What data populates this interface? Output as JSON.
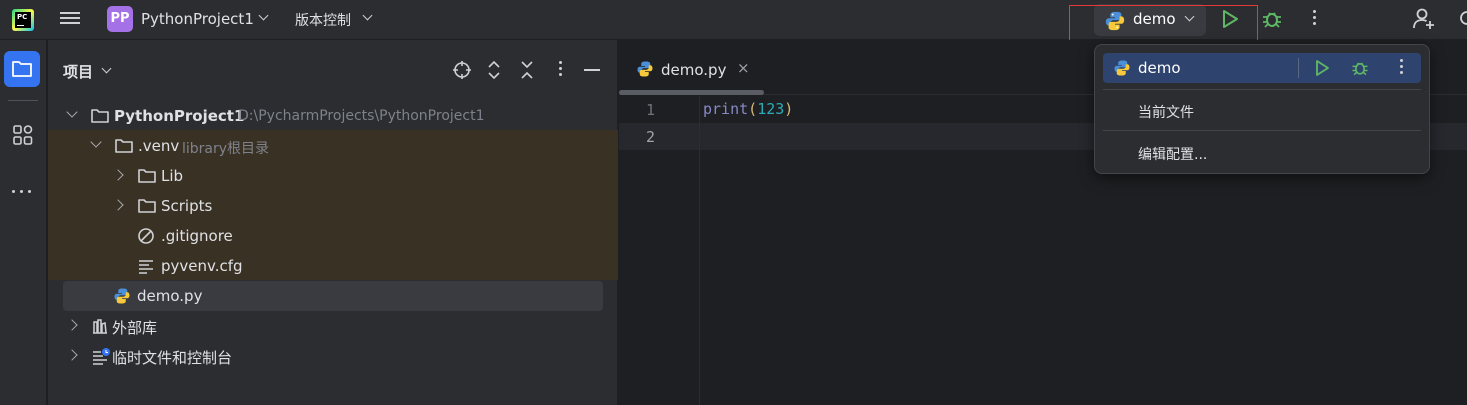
{
  "titlebar": {
    "project_badge": "PP",
    "project_name": "PythonProject1",
    "vcs_label": "版本控制",
    "run_config_label": "demo"
  },
  "project_panel": {
    "title": "项目",
    "tree": [
      {
        "label": "PythonProject1",
        "hint": "D:\\PycharmProjects\\PythonProject1",
        "bold": true
      },
      {
        "label": ".venv",
        "hint": "library根目录"
      },
      {
        "label": "Lib"
      },
      {
        "label": "Scripts"
      },
      {
        "label": ".gitignore"
      },
      {
        "label": "pyvenv.cfg"
      },
      {
        "label": "demo.py"
      },
      {
        "label": "外部库"
      },
      {
        "label": "临时文件和控制台"
      }
    ]
  },
  "editor": {
    "tab_label": "demo.py",
    "tab_close": "×",
    "line_numbers": [
      "1",
      "2"
    ],
    "code": {
      "fn": "print",
      "open": "(",
      "num": "123",
      "close": ")"
    }
  },
  "run_dropdown": {
    "selected": "demo",
    "items": [
      "当前文件",
      "编辑配置..."
    ]
  },
  "colors": {
    "accent": "#3574f0",
    "run_green": "#5fb865",
    "highlight_red": "#e53935",
    "venv_band": "#3a3125"
  }
}
